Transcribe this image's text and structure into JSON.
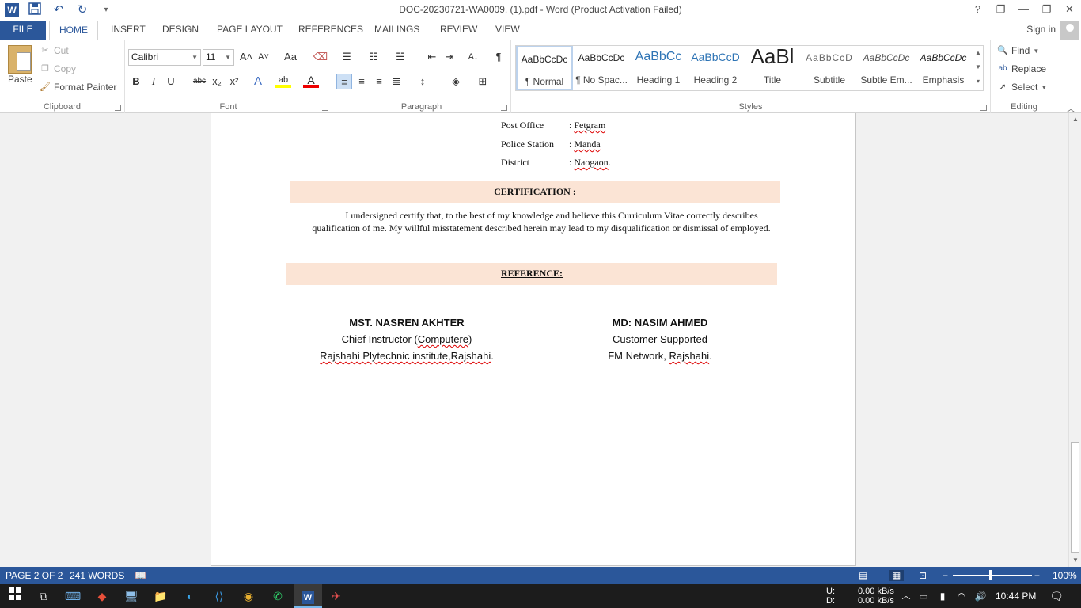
{
  "window": {
    "title": "DOC-20230721-WA0009. (1).pdf - Word (Product Activation Failed)",
    "help": "?",
    "ribbon_display": "❐",
    "minimize": "—",
    "restore": "❐",
    "close": "✕"
  },
  "qat": {
    "logo": "W",
    "save": "💾",
    "undo": "↶",
    "redo": "↻",
    "more": "▾"
  },
  "tabs": [
    "FILE",
    "HOME",
    "INSERT",
    "DESIGN",
    "PAGE LAYOUT",
    "REFERENCES",
    "MAILINGS",
    "REVIEW",
    "VIEW"
  ],
  "account": {
    "sign_in": "Sign in"
  },
  "ribbon": {
    "clipboard": {
      "paste": "Paste",
      "cut": "Cut",
      "copy": "Copy",
      "format_painter": "Format Painter",
      "label": "Clipboard"
    },
    "font": {
      "name": "Calibri",
      "size": "11",
      "label": "Font",
      "bold": "B",
      "italic": "I",
      "underline": "U",
      "strike": "abc",
      "sub": "x₂",
      "sup": "x²",
      "grow": "A˄",
      "shrink": "A˅",
      "case": "Aa",
      "effects": "A",
      "highlight": "ab",
      "color": "A"
    },
    "paragraph": {
      "label": "Paragraph",
      "pilcrow": "¶",
      "sort": "A↓"
    },
    "styles": {
      "label": "Styles",
      "items": [
        {
          "sample": "AaBbCcDc",
          "name": "¶ Normal"
        },
        {
          "sample": "AaBbCcDc",
          "name": "¶ No Spac..."
        },
        {
          "sample": "AaBbCc",
          "name": "Heading 1"
        },
        {
          "sample": "AaBbCcD",
          "name": "Heading 2"
        },
        {
          "sample": "AaBl",
          "name": "Title"
        },
        {
          "sample": "AaBbCcD",
          "name": "Subtitle"
        },
        {
          "sample": "AaBbCcDc",
          "name": "Subtle Em..."
        },
        {
          "sample": "AaBbCcDc",
          "name": "Emphasis"
        }
      ]
    },
    "editing": {
      "label": "Editing",
      "find": "Find",
      "replace": "Replace",
      "select": "Select"
    }
  },
  "document": {
    "address": [
      {
        "key": "Post Office",
        "value": ": Fetgram",
        "squiggle": "Fetgram"
      },
      {
        "key": "Police Station",
        "value": ": Manda",
        "squiggle": "Manda"
      },
      {
        "key": "District",
        "value": ": Naogaon.",
        "squiggle": "Naogaon"
      }
    ],
    "certification_heading": "CERTIFICATION",
    "certification_suffix": " :",
    "certification_text": "I undersigned certify that, to the best of my knowledge and believe this Curriculum Vitae correctly describes qualification of me. My willful misstatement described herein may lead to my disqualification or dismissal of employed.",
    "reference_heading": "REFERENCE:",
    "references": [
      {
        "name": "MST. NASREN AKHTER",
        "role": "Chief Instructor (Computere)",
        "org": "Rajshahi Plytechnic institute,Rajshahi."
      },
      {
        "name": "MD: NASIM AHMED",
        "role": "Customer Supported",
        "org": "FM Network, Rajshahi."
      }
    ]
  },
  "status": {
    "page": "PAGE 2 OF 2",
    "words": "241 WORDS",
    "zoom": "100%",
    "zoom_minus": "−",
    "zoom_plus": "+"
  },
  "taskbar": {
    "net_up_label": "U:",
    "net_down_label": "D:",
    "net_up": "0.00 kB/s",
    "net_down": "0.00 kB/s",
    "time": "10:44 PM"
  },
  "colors": {
    "word_blue": "#2b579a",
    "section_band": "#fbe4d5",
    "taskbar": "#1c1c1c"
  }
}
